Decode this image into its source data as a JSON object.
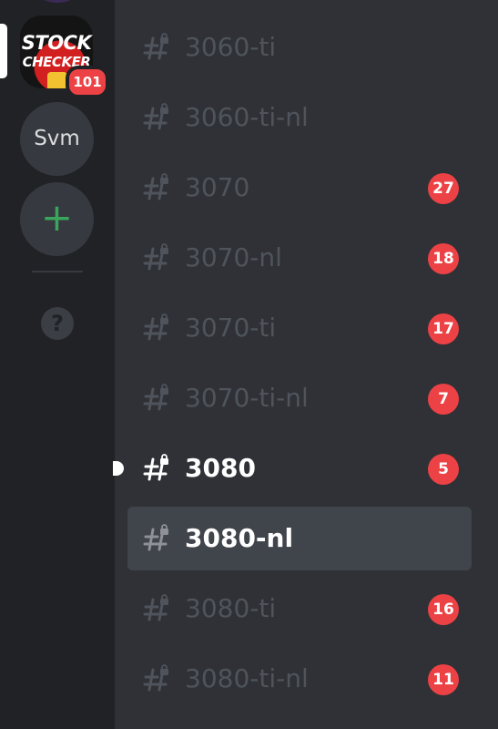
{
  "colors": {
    "rail_bg": "#202225",
    "channel_bg": "#2f3136",
    "selected_bg": "#40444b",
    "badge_red": "#ed4245",
    "add_green": "#3ba55d",
    "muted_text": "#4f545c",
    "active_text": "#ffffff"
  },
  "servers": {
    "stock_checker": {
      "logo_line1": "STOCK",
      "logo_line2": "CHECKER",
      "badge": "101"
    },
    "svm": {
      "label": "Svm"
    },
    "add": {
      "icon": "plus-icon",
      "label": "+"
    },
    "help": {
      "icon": "help-icon",
      "label": "?"
    }
  },
  "channels": [
    {
      "name": "3060-ti",
      "badge": "",
      "state": "read"
    },
    {
      "name": "3060-ti-nl",
      "badge": "",
      "state": "read"
    },
    {
      "name": "3070",
      "badge": "27",
      "state": "read"
    },
    {
      "name": "3070-nl",
      "badge": "18",
      "state": "read"
    },
    {
      "name": "3070-ti",
      "badge": "17",
      "state": "read"
    },
    {
      "name": "3070-ti-nl",
      "badge": "7",
      "state": "read"
    },
    {
      "name": "3080",
      "badge": "5",
      "state": "unread"
    },
    {
      "name": "3080-nl",
      "badge": "",
      "state": "selected"
    },
    {
      "name": "3080-ti",
      "badge": "16",
      "state": "read"
    },
    {
      "name": "3080-ti-nl",
      "badge": "11",
      "state": "read"
    }
  ]
}
